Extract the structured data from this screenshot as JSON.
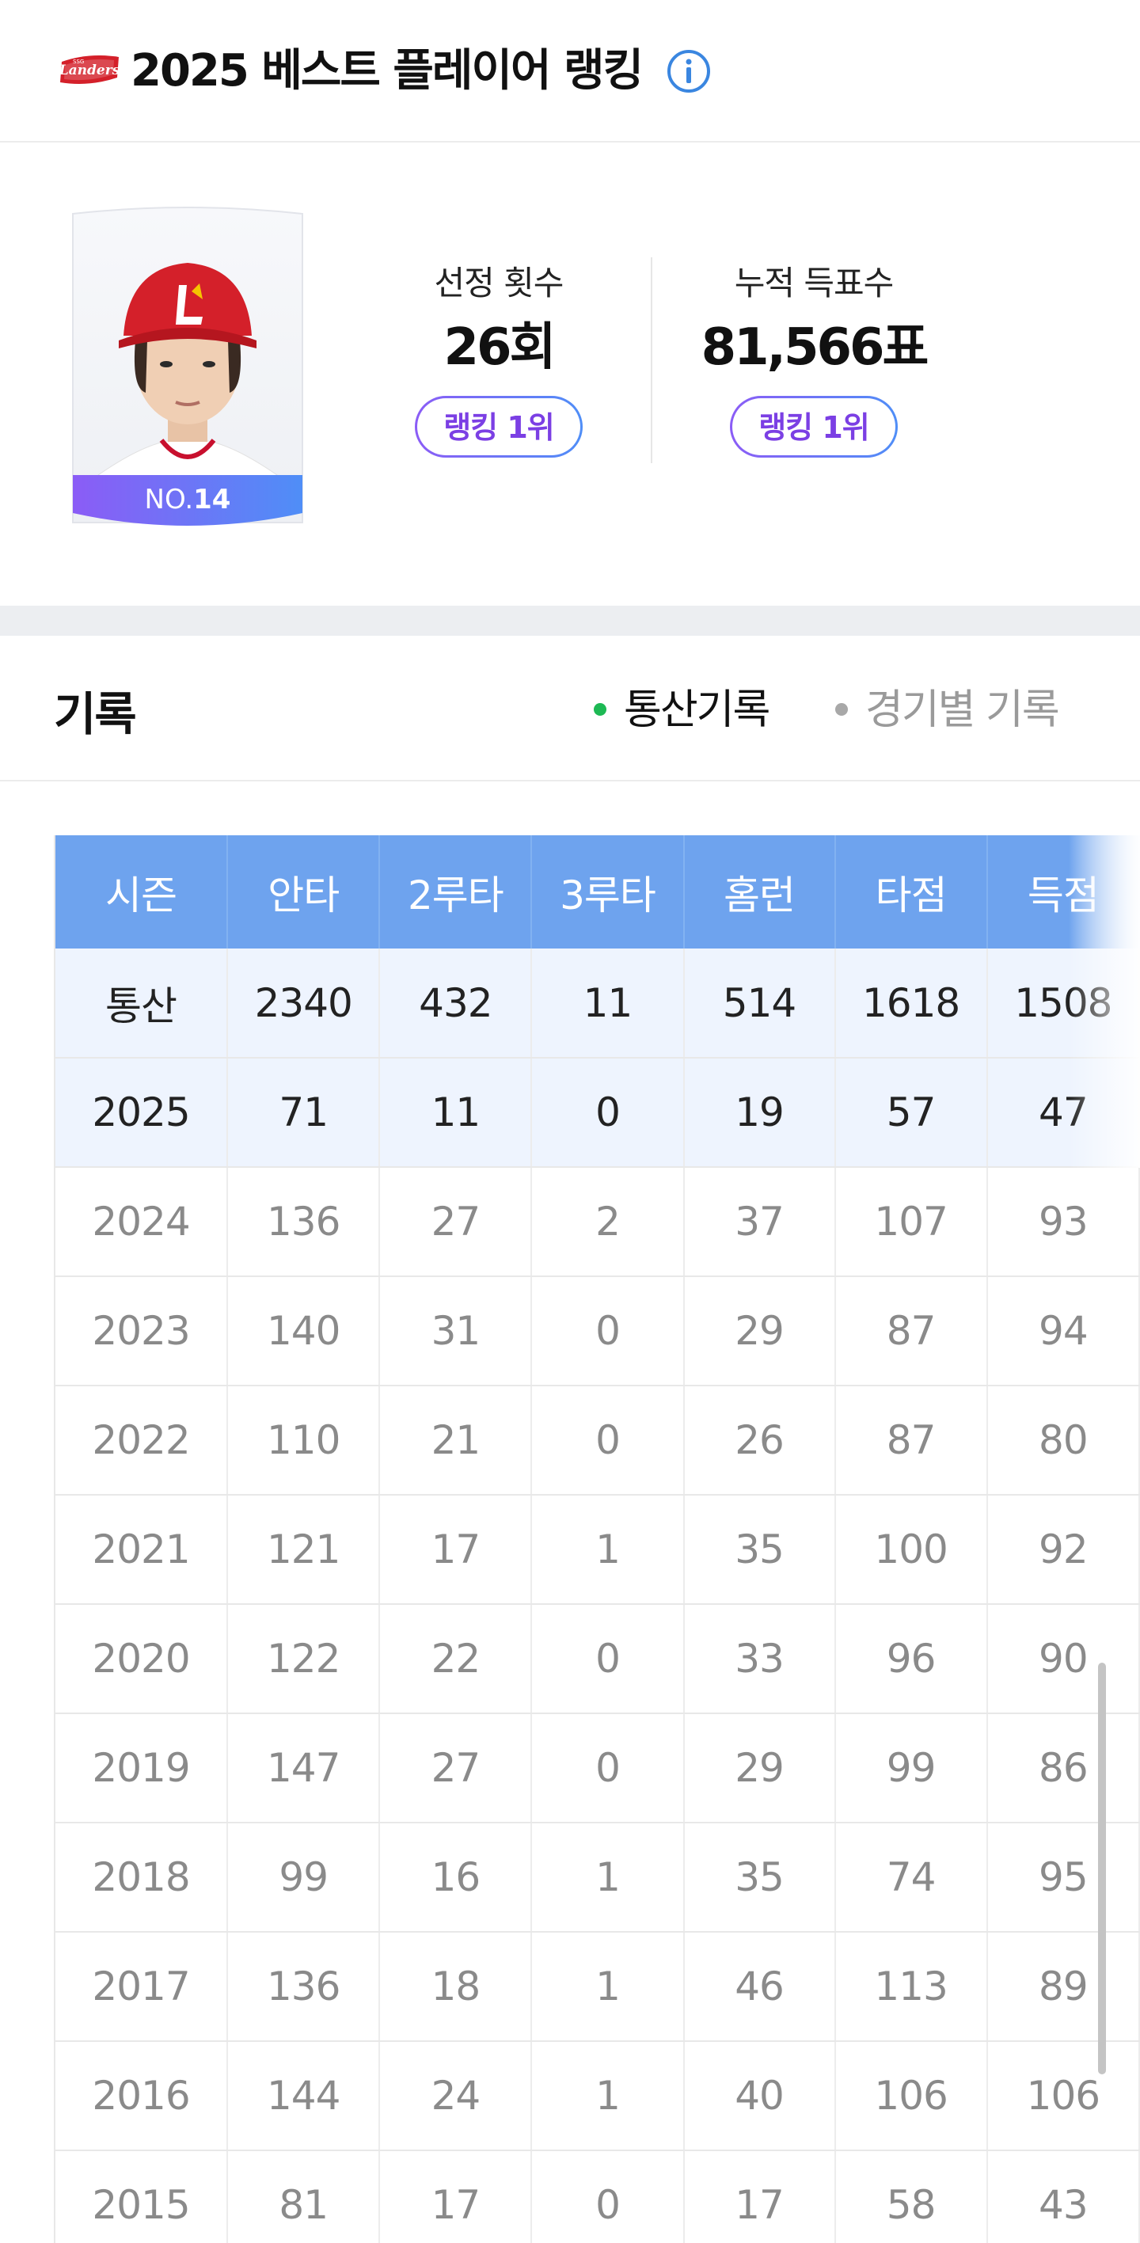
{
  "header": {
    "title": "2025 베스트 플레이어 랭킹",
    "logo_text": "SSG Landers"
  },
  "player": {
    "number_prefix": "NO.",
    "number": "14"
  },
  "stats": {
    "selection": {
      "label": "선정 횟수",
      "value": "26회",
      "rank": "랭킹 1위"
    },
    "votes": {
      "label": "누적 득표수",
      "value": "81,566표",
      "rank": "랭킹 1위"
    }
  },
  "records": {
    "title": "기록",
    "tabs": [
      {
        "label": "통산기록",
        "active": true
      },
      {
        "label": "경기별 기록",
        "active": false
      }
    ]
  },
  "table": {
    "headers": [
      "시즌",
      "안타",
      "2루타",
      "3루타",
      "홈런",
      "타점",
      "득점"
    ],
    "rows": [
      {
        "cells": [
          "통산",
          "2340",
          "432",
          "11",
          "514",
          "1618",
          "1508"
        ],
        "highlight": true
      },
      {
        "cells": [
          "2025",
          "71",
          "11",
          "0",
          "19",
          "57",
          "47"
        ],
        "highlight": true
      },
      {
        "cells": [
          "2024",
          "136",
          "27",
          "2",
          "37",
          "107",
          "93"
        ],
        "highlight": false
      },
      {
        "cells": [
          "2023",
          "140",
          "31",
          "0",
          "29",
          "87",
          "94"
        ],
        "highlight": false
      },
      {
        "cells": [
          "2022",
          "110",
          "21",
          "0",
          "26",
          "87",
          "80"
        ],
        "highlight": false
      },
      {
        "cells": [
          "2021",
          "121",
          "17",
          "1",
          "35",
          "100",
          "92"
        ],
        "highlight": false
      },
      {
        "cells": [
          "2020",
          "122",
          "22",
          "0",
          "33",
          "96",
          "90"
        ],
        "highlight": false
      },
      {
        "cells": [
          "2019",
          "147",
          "27",
          "0",
          "29",
          "99",
          "86"
        ],
        "highlight": false
      },
      {
        "cells": [
          "2018",
          "99",
          "16",
          "1",
          "35",
          "74",
          "95"
        ],
        "highlight": false
      },
      {
        "cells": [
          "2017",
          "136",
          "18",
          "1",
          "46",
          "113",
          "89"
        ],
        "highlight": false
      },
      {
        "cells": [
          "2016",
          "144",
          "24",
          "1",
          "40",
          "106",
          "106"
        ],
        "highlight": false
      },
      {
        "cells": [
          "2015",
          "81",
          "17",
          "0",
          "17",
          "58",
          "43"
        ],
        "highlight": false
      }
    ]
  },
  "colors": {
    "table_header": "#6ea3ee",
    "highlight_row": "#eef4fe",
    "rank_text": "#7b3fe4",
    "active_dot": "#1db954",
    "brand_red": "#d4202a"
  },
  "icons": {
    "logo": "landers-logo",
    "info": "info-icon"
  }
}
